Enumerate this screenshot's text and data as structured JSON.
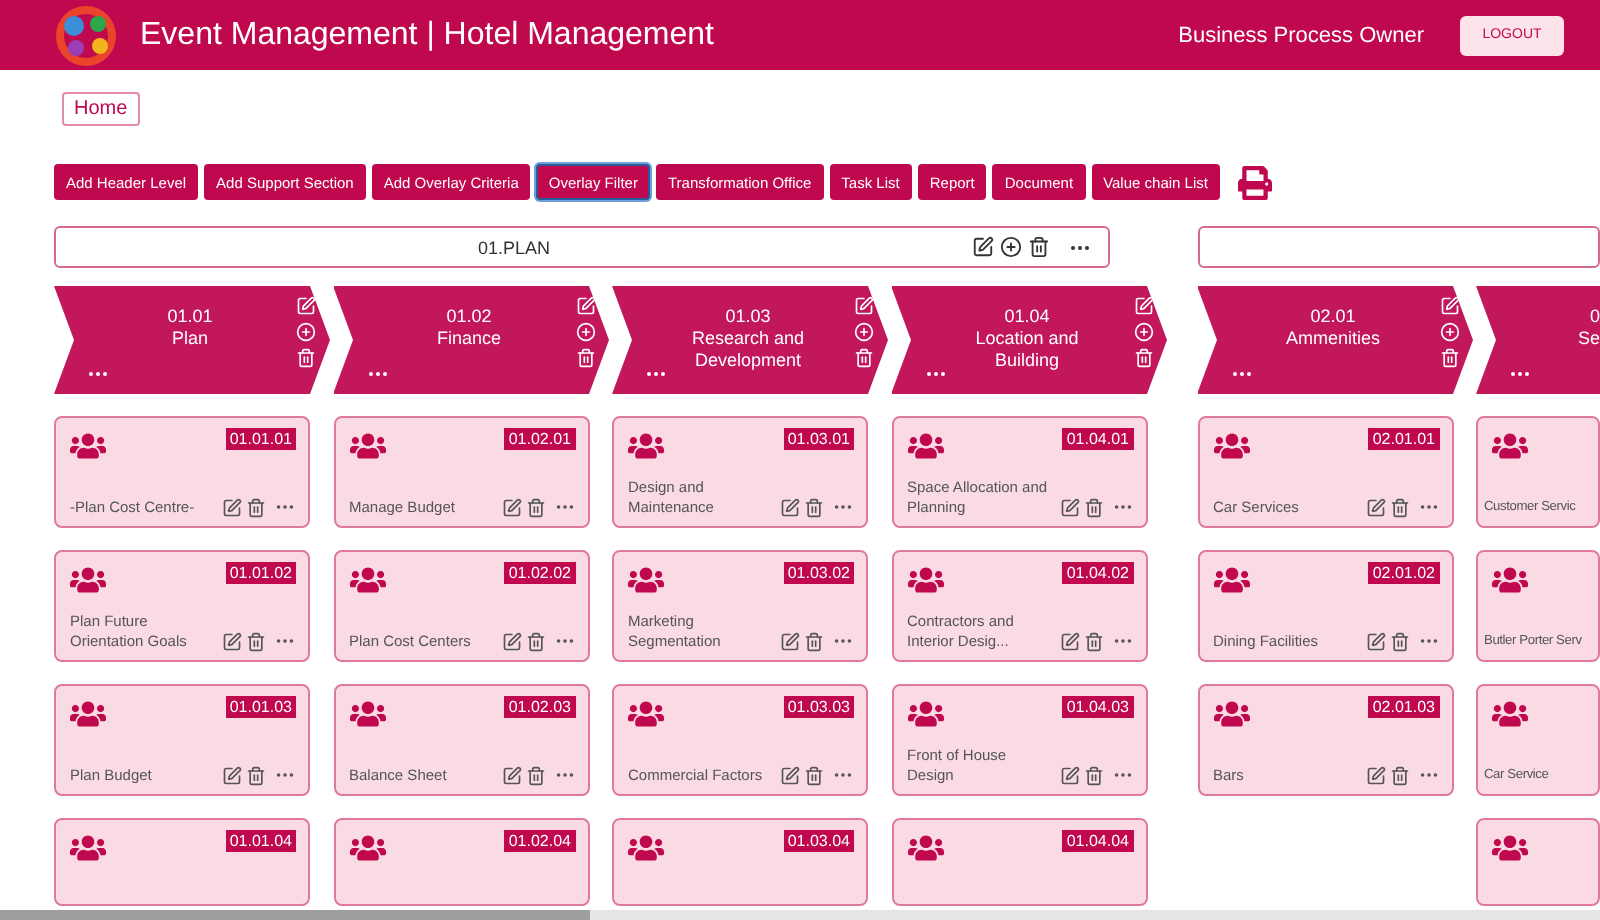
{
  "header": {
    "title": "Event Management | Hotel Management",
    "role": "Business Process Owner",
    "logout": "LOGOUT"
  },
  "breadcrumb": "Home",
  "toolbar": [
    {
      "label": "Add Header Level",
      "selected": false
    },
    {
      "label": "Add Support Section",
      "selected": false
    },
    {
      "label": "Add Overlay Criteria",
      "selected": false
    },
    {
      "label": "Overlay Filter",
      "selected": true
    },
    {
      "label": "Transformation Office",
      "selected": false
    },
    {
      "label": "Task List",
      "selected": false
    },
    {
      "label": "Report",
      "selected": false
    },
    {
      "label": "Document",
      "selected": false
    },
    {
      "label": "Value chain List",
      "selected": false
    }
  ],
  "groups": [
    {
      "title": "01.PLAN",
      "columns": [
        {
          "code": "01.01",
          "label": "Plan",
          "cut": false,
          "cards": [
            {
              "code": "01.01.01",
              "name": "-Plan Cost Centre-"
            },
            {
              "code": "01.01.02",
              "name": "Plan Future Orientation Goals"
            },
            {
              "code": "01.01.03",
              "name": "Plan Budget"
            },
            {
              "code": "01.01.04",
              "kind": "partial"
            }
          ]
        },
        {
          "code": "01.02",
          "label": "Finance",
          "cut": false,
          "cards": [
            {
              "code": "01.02.01",
              "name": "Manage Budget"
            },
            {
              "code": "01.02.02",
              "name": "Plan Cost Centers"
            },
            {
              "code": "01.02.03",
              "name": "Balance Sheet"
            },
            {
              "code": "01.02.04",
              "kind": "partial"
            }
          ]
        },
        {
          "code": "01.03",
          "label": "Research and Development",
          "cut": false,
          "cards": [
            {
              "code": "01.03.01",
              "name": "Design and Maintenance"
            },
            {
              "code": "01.03.02",
              "name": "Marketing Segmentation"
            },
            {
              "code": "01.03.03",
              "name": "Commercial Factors"
            },
            {
              "code": "01.03.04",
              "kind": "partial"
            }
          ]
        },
        {
          "code": "01.04",
          "label": "Location and Building",
          "cut": false,
          "cards": [
            {
              "code": "01.04.01",
              "name": "Space Allocation and Planning"
            },
            {
              "code": "01.04.02",
              "name": "Contractors and Interior Desig..."
            },
            {
              "code": "01.04.03",
              "name": "Front of House Design"
            },
            {
              "code": "01.04.04",
              "kind": "partial"
            }
          ]
        }
      ]
    },
    {
      "columns": [
        {
          "code": "02.01",
          "label": "Ammenities",
          "cut": false,
          "cards": [
            {
              "code": "02.01.01",
              "name": "Car Services"
            },
            {
              "code": "02.01.02",
              "name": "Dining Facilities"
            },
            {
              "code": "02.01.03",
              "name": "Bars"
            }
          ]
        },
        {
          "code": "0",
          "label": "Se",
          "cut": true,
          "cards": [
            {
              "name": "Customer Servic"
            },
            {
              "name": "Butler Porter Serv"
            },
            {
              "name": "Car Service"
            },
            {
              "kind": "partial"
            }
          ]
        }
      ]
    }
  ]
}
